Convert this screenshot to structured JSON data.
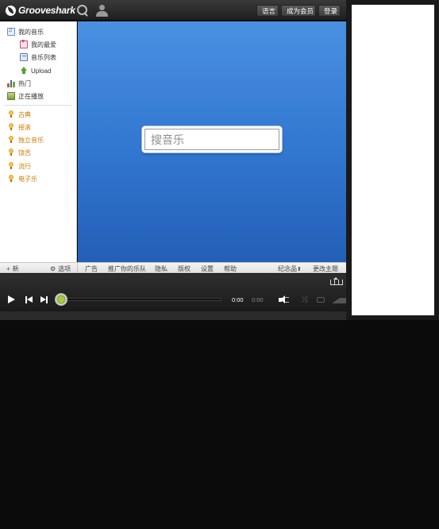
{
  "header": {
    "logo_text": "Grooveshark",
    "language_label": "语言",
    "member_label": "成为会员",
    "login_label": "登录"
  },
  "sidebar": {
    "items": [
      {
        "label": "我的音乐",
        "icon": "music-icon"
      },
      {
        "label": "我的最爱",
        "icon": "heart-icon"
      },
      {
        "label": "音乐列表",
        "icon": "playlist-icon"
      },
      {
        "label": "Upload",
        "icon": "upload-icon"
      },
      {
        "label": "热门",
        "icon": "popular-chart-icon"
      },
      {
        "label": "正在播放",
        "icon": "now-playing-icon"
      }
    ],
    "stations": [
      {
        "label": "古典"
      },
      {
        "label": "摇滚"
      },
      {
        "label": "独立音乐"
      },
      {
        "label": "饶舌"
      },
      {
        "label": "流行"
      },
      {
        "label": "电子乐"
      }
    ],
    "new_label": "新",
    "options_label": "选项"
  },
  "main": {
    "search_placeholder": "搜音乐"
  },
  "linkbar": {
    "links": [
      "广告",
      "推广你的乐队",
      "隐私",
      "版权",
      "设置",
      "帮助"
    ],
    "merch_label": "纪念品",
    "theme_label": "更改主题"
  },
  "player": {
    "time_elapsed": "0:00",
    "time_total": "0:00",
    "progress": 0
  },
  "colors": {
    "main_bg_top": "#4a90e2",
    "main_bg_bottom": "#235fb7",
    "station_text": "#d07b00",
    "progress_accent": "#8fb33a",
    "topbar": "#2a2a2a"
  }
}
